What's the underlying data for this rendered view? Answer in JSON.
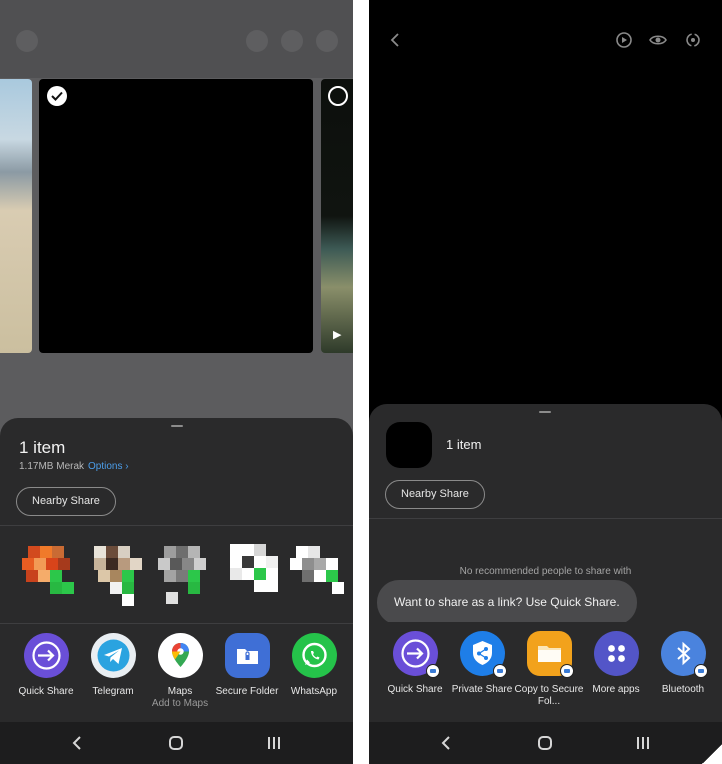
{
  "left": {
    "share_sheet": {
      "item_count": "1 item",
      "file_info": "1.17MB Merak",
      "options_label": "Options",
      "nearby_share_label": "Nearby Share"
    },
    "apps": [
      {
        "label": "Quick Share",
        "sub": "",
        "icon": "quick-share-icon"
      },
      {
        "label": "Telegram",
        "sub": "",
        "icon": "telegram-icon"
      },
      {
        "label": "Maps",
        "sub": "Add to Maps",
        "icon": "maps-pin-icon"
      },
      {
        "label": "Secure Folder",
        "sub": "",
        "icon": "secure-folder-icon"
      },
      {
        "label": "WhatsApp",
        "sub": "",
        "icon": "whatsapp-icon"
      }
    ]
  },
  "right": {
    "share_sheet": {
      "item_count": "1 item",
      "nearby_share_label": "Nearby Share",
      "no_recommendations": "No recommended people to share with",
      "tooltip": "Want to share as a link? Use Quick Share."
    },
    "apps": [
      {
        "label": "Quick Share",
        "icon": "quick-share-icon"
      },
      {
        "label": "Private Share",
        "icon": "private-share-icon"
      },
      {
        "label": "Copy to Secure Fol...",
        "icon": "secure-folder-icon"
      },
      {
        "label": "More apps",
        "icon": "more-apps-icon"
      },
      {
        "label": "Bluetooth",
        "icon": "bluetooth-icon"
      }
    ]
  },
  "colors": {
    "sheet_bg": "#2a2a2b",
    "accent_link": "#4c9eea",
    "quick_share": "#6a4fd8",
    "telegram": "#2aa3e0",
    "whatsapp": "#25c34a",
    "private_share": "#1e7ee8",
    "secure_folder": "#3f6fd6",
    "copy_folder": "#f2a21c",
    "more_apps": "#5355c8",
    "bluetooth": "#4a83de"
  }
}
